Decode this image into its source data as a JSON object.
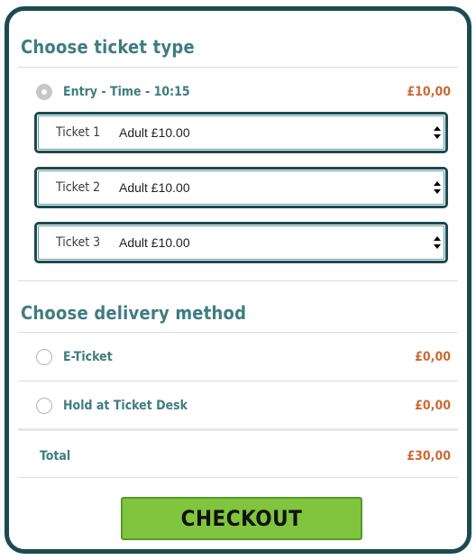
{
  "ticket_section": {
    "title": "Choose ticket type",
    "entry": {
      "label": "Entry - Time - 10:15",
      "price": "£10,00",
      "selected": true
    },
    "tickets": [
      {
        "label": "Ticket 1",
        "value": "Adult £10.00"
      },
      {
        "label": "Ticket 2",
        "value": "Adult £10.00"
      },
      {
        "label": "Ticket 3",
        "value": "Adult £10.00"
      }
    ]
  },
  "delivery_section": {
    "title": "Choose delivery method",
    "options": [
      {
        "label": "E-Ticket",
        "price": "£0,00",
        "selected": false
      },
      {
        "label": "Hold at Ticket Desk",
        "price": "£0,00",
        "selected": false
      }
    ]
  },
  "total": {
    "label": "Total",
    "price": "£30,00"
  },
  "checkout_label": "CHECKOUT",
  "colors": {
    "frame": "#1d4a51",
    "heading": "#3f7c7f",
    "price": "#cc6a32",
    "checkout": "#80c53d"
  }
}
